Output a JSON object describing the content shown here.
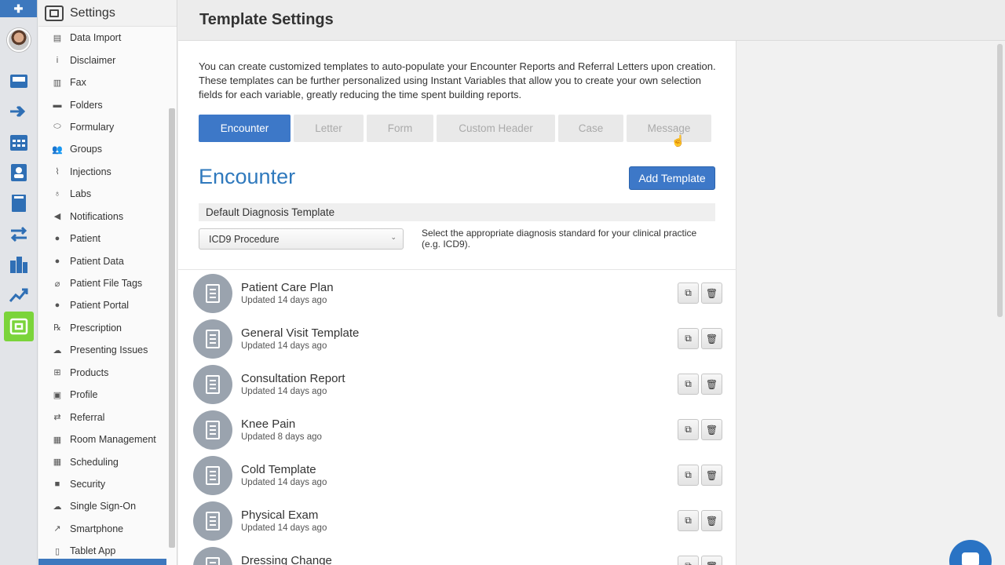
{
  "rail": {
    "top_icon": "plus-cross-icon",
    "icons": [
      "inbox-icon",
      "forward-arrows-icon",
      "calendar-icon",
      "contact-book-icon",
      "book-icon",
      "transfer-arrows-icon",
      "buildings-icon",
      "trend-chart-icon",
      "settings-box-icon"
    ],
    "active_color": "#7bd43a"
  },
  "settings_menu": {
    "title": "Settings",
    "items": [
      {
        "label": "Data Import",
        "icon": "database-icon"
      },
      {
        "label": "Disclaimer",
        "icon": "info-icon"
      },
      {
        "label": "Fax",
        "icon": "fax-icon"
      },
      {
        "label": "Folders",
        "icon": "folder-icon"
      },
      {
        "label": "Formulary",
        "icon": "pill-icon"
      },
      {
        "label": "Groups",
        "icon": "group-icon"
      },
      {
        "label": "Injections",
        "icon": "syringe-icon"
      },
      {
        "label": "Labs",
        "icon": "flask-icon"
      },
      {
        "label": "Notifications",
        "icon": "megaphone-icon"
      },
      {
        "label": "Patient",
        "icon": "person-icon"
      },
      {
        "label": "Patient Data",
        "icon": "person-icon"
      },
      {
        "label": "Patient File Tags",
        "icon": "paperclip-icon"
      },
      {
        "label": "Patient Portal",
        "icon": "person-icon"
      },
      {
        "label": "Prescription",
        "icon": "prescription-icon"
      },
      {
        "label": "Presenting Issues",
        "icon": "cloud-icon"
      },
      {
        "label": "Products",
        "icon": "cart-icon"
      },
      {
        "label": "Profile",
        "icon": "id-card-icon"
      },
      {
        "label": "Referral",
        "icon": "referral-icon"
      },
      {
        "label": "Room Management",
        "icon": "calendar-small-icon"
      },
      {
        "label": "Scheduling",
        "icon": "calendar-small-icon"
      },
      {
        "label": "Security",
        "icon": "lock-icon"
      },
      {
        "label": "Single Sign-On",
        "icon": "cloud-upload-icon"
      },
      {
        "label": "Smartphone",
        "icon": "share-icon"
      },
      {
        "label": "Tablet App",
        "icon": "tablet-icon"
      }
    ]
  },
  "page": {
    "title": "Template Settings",
    "description": "You can create customized templates to auto-populate your Encounter Reports and Referral Letters upon creation. These templates can be further personalized using Instant Variables that allow you to create your own selection fields for each variable, greatly reducing the time spent building reports."
  },
  "tabs": [
    {
      "label": "Encounter",
      "active": true
    },
    {
      "label": "Letter",
      "active": false
    },
    {
      "label": "Form",
      "active": false
    },
    {
      "label": "Custom Header",
      "active": false
    },
    {
      "label": "Case",
      "active": false
    },
    {
      "label": "Message",
      "active": false
    }
  ],
  "section": {
    "title": "Encounter",
    "add_button": "Add Template",
    "diagnosis_label": "Default Diagnosis Template",
    "diagnosis_value": "ICD9 Procedure",
    "diagnosis_help": "Select the appropriate diagnosis standard for your clinical practice (e.g. ICD9)."
  },
  "templates": [
    {
      "name": "Patient Care Plan",
      "updated": "Updated 14 days ago"
    },
    {
      "name": "General Visit Template",
      "updated": "Updated 14 days ago"
    },
    {
      "name": "Consultation Report",
      "updated": "Updated 14 days ago"
    },
    {
      "name": "Knee Pain",
      "updated": "Updated 8 days ago"
    },
    {
      "name": "Cold Template",
      "updated": "Updated 14 days ago"
    },
    {
      "name": "Physical Exam",
      "updated": "Updated 14 days ago"
    },
    {
      "name": "Dressing Change",
      "updated": ""
    }
  ],
  "colors": {
    "accent": "#3d78c8",
    "title_blue": "#2f79bd",
    "active_nav": "#7bd43a"
  }
}
